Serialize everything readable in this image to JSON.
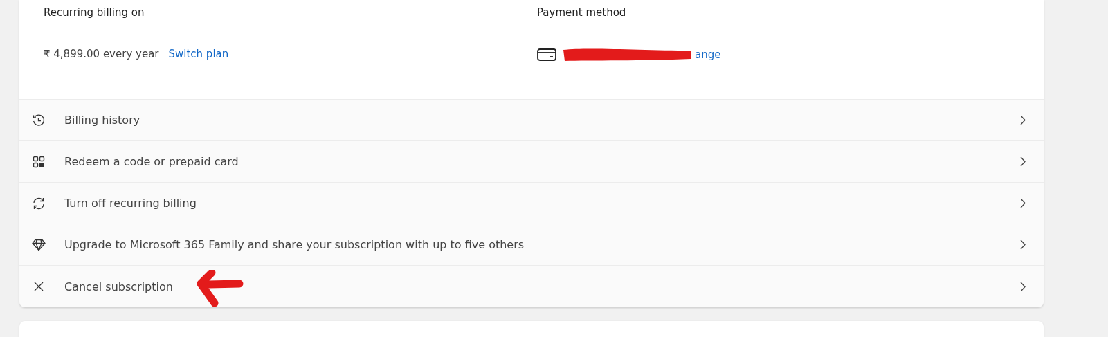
{
  "billing": {
    "label": "Recurring billing on",
    "price": "₹ 4,899.00 every year",
    "link": "Switch plan"
  },
  "payment": {
    "label": "Payment method",
    "link": "ange"
  },
  "actions": [
    {
      "kind": "history",
      "label": "Billing history"
    },
    {
      "kind": "redeem",
      "label": "Redeem a code or prepaid card"
    },
    {
      "kind": "recurring",
      "label": "Turn off recurring billing"
    },
    {
      "kind": "upgrade",
      "label": "Upgrade to Microsoft 365 Family and share your subscription with up to five others"
    },
    {
      "kind": "cancel",
      "label": "Cancel subscription"
    }
  ]
}
